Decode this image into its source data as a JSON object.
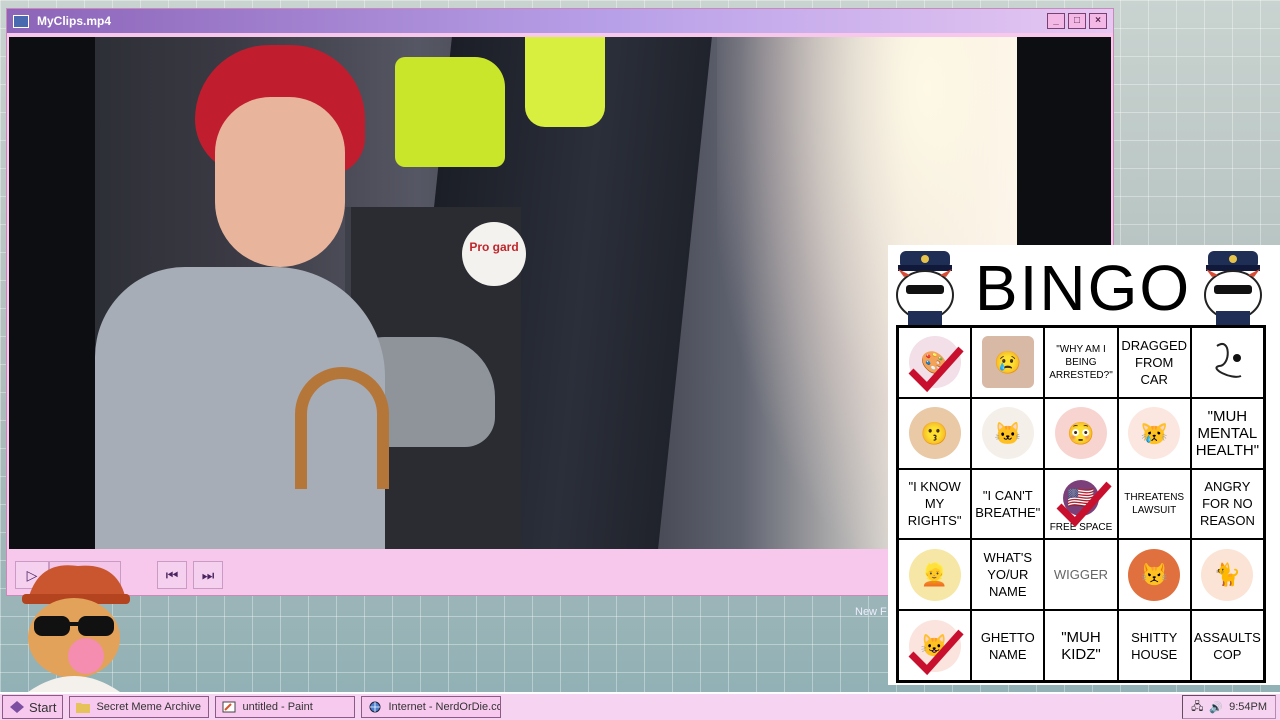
{
  "window": {
    "title": "MyClips.mp4",
    "buttons": [
      "_",
      "□",
      "×"
    ]
  },
  "video": {
    "sticker_text": "Pro gard"
  },
  "controls": {
    "play": "▷",
    "prev": "⏮",
    "next": "⏭"
  },
  "bingo": {
    "title": "BINGO",
    "cells": [
      {
        "text": "",
        "icon": "anime-girl-icon",
        "checked": true
      },
      {
        "text": "",
        "icon": "crying-woman-icon",
        "checked": false
      },
      {
        "text": "\"WHY AM I BEING ARRESTED?\"",
        "checked": false
      },
      {
        "text": "DRAGGED FROM CAR",
        "checked": false
      },
      {
        "text": "",
        "icon": "squiggle-icon",
        "checked": false
      },
      {
        "text": "",
        "icon": "spiky-hair-character-icon",
        "checked": false
      },
      {
        "text": "",
        "icon": "driving-cat-icon",
        "checked": false
      },
      {
        "text": "",
        "icon": "pink-hair-character-icon",
        "checked": false
      },
      {
        "text": "",
        "icon": "sad-cat-icon",
        "checked": false
      },
      {
        "text": "\"MUH MENTAL HEALTH\"",
        "checked": false
      },
      {
        "text": "\"I KNOW MY RIGHTS\"",
        "checked": false
      },
      {
        "text": "\"I CAN'T BREATHE\"",
        "checked": false
      },
      {
        "text": "FREE SPACE",
        "icon": "free-space-icon",
        "checked": true
      },
      {
        "text": "THREATENS LAWSUIT",
        "checked": false
      },
      {
        "text": "ANGRY FOR NO REASON",
        "checked": false
      },
      {
        "text": "",
        "icon": "blonde-character-icon",
        "checked": false
      },
      {
        "text": "WHAT'S YO/UR NAME",
        "checked": false
      },
      {
        "text": "WIGGER",
        "checked": false
      },
      {
        "text": "",
        "icon": "orange-cat-icon",
        "checked": false
      },
      {
        "text": "",
        "icon": "thinking-cat-icon",
        "checked": false
      },
      {
        "text": "",
        "icon": "cat-icon",
        "checked": true
      },
      {
        "text": "GHETTO NAME",
        "checked": false
      },
      {
        "text": "\"MUH KIDZ\"",
        "checked": false
      },
      {
        "text": "SHITTY HOUSE",
        "checked": false
      },
      {
        "text": "ASSAULTS COP",
        "checked": false
      }
    ]
  },
  "desktop": {
    "new_folder_label": "New F"
  },
  "taskbar": {
    "start_label": "Start",
    "tasks": [
      {
        "label": "Secret Meme Archive",
        "icon": "folder-icon"
      },
      {
        "label": "untitled - Paint",
        "icon": "paint-icon"
      },
      {
        "label": "Internet - NerdOrDie.com",
        "icon": "globe-icon"
      }
    ],
    "clock": "9:54PM"
  }
}
